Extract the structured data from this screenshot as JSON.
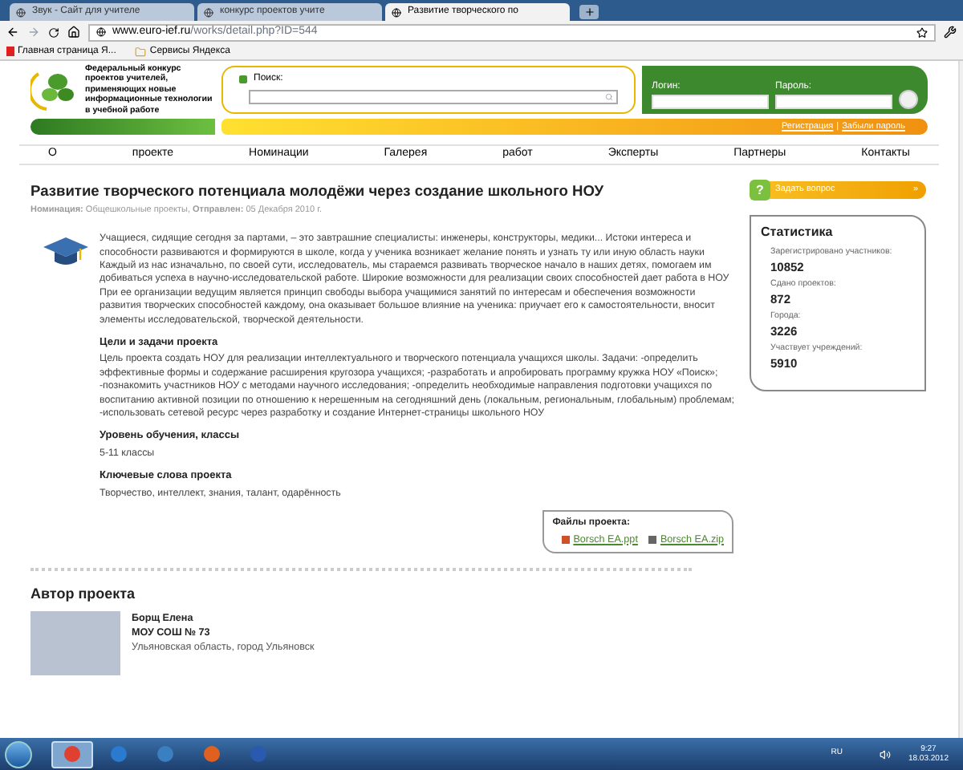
{
  "browser": {
    "tabs": [
      {
        "label": "Звук - Сайт для учителе",
        "selected": false
      },
      {
        "label": "конкурс проектов учите",
        "selected": false
      },
      {
        "label": "Развитие творческого по",
        "selected": true
      }
    ],
    "url_host": "www.euro-ief.ru",
    "url_path": "/works/detail.php?ID=544",
    "bookmarks": [
      {
        "label": "Главная страница Я...",
        "kind": "page"
      },
      {
        "label": "Сервисы Яндекса",
        "kind": "folder"
      }
    ]
  },
  "header": {
    "logo_text": "Федеральный конкурс проектов учителей, применяющих новые информационные технологии в учебной работе",
    "search_label": "Поиск:",
    "login_label": "Логин:",
    "password_label": "Пароль:",
    "links": [
      "Регистрация",
      "Забыли пароль"
    ],
    "link_separator": "|"
  },
  "nav": [
    "О",
    "проекте",
    "Номинации",
    "Галерея",
    "работ",
    "Эксперты",
    "Партнеры",
    "Контакты"
  ],
  "article": {
    "title": "Развитие творческого потенциала молодёжи через создание школьного НОУ",
    "meta": "**Номинация:** Общешкольные проекты, **Отправлен:** 05 Декабря 2010 г.",
    "intro": "Учащиеся, сидящие сегодня за партами, – это завтрашние специалисты: инженеры, конструкторы, медики... Истоки интереса и способности развиваются и формируются в школе, когда у ученика возникает желание понять и узнать ту или иную область науки Каждый из нас изначально, по своей сути, исследователь, мы стараемся развивать творческое начало в наших детях, помогаем им добиваться успеха в научно-исследовательской работе. Широкие возможности для реализации своих способностей дает работа в НОУ При ее организации ведущим является принцип свободы выбора учащимися занятий по интересам и обеспечения возможности развития творческих способностей каждому, она оказывает большое влияние на ученика: приучает его к самостоятельности, вносит элементы исследовательской, творческой деятельности.",
    "sections": [
      {
        "heading": "Цели и задачи проекта",
        "text": "Цель проекта создать НОУ для реализации интеллектуального и творческого потенциала учащихся школы. Задачи: -определить эффективные формы и содержание расширения кругозора учащихся; -разработать и апробировать программу кружка НОУ «Поиск»; -познакомить участников НОУ с методами научного исследования; -определить необходимые направления подготовки учащихся по воспитанию активной позиции по отношению к нерешенным на сегодняшний день (локальным, региональным, глобальным) проблемам; -использовать сетевой ресурс через разработку и создание Интернет-страницы школьного НОУ"
      },
      {
        "heading": "Уровень обучения, классы",
        "text": "5-11 классы"
      },
      {
        "heading": "Ключевые слова проекта",
        "text": "Творчество, интеллект, знания, талант, одарённость"
      }
    ],
    "files_title": "Файлы проекта:",
    "files": [
      {
        "name": "Borsch EA.ppt",
        "kind": "ppt"
      },
      {
        "name": "Borsch EA.zip",
        "kind": "zip"
      }
    ]
  },
  "author": {
    "heading": "Автор проекта",
    "name": "Борщ Елена",
    "school": "МОУ СОШ № 73",
    "location": "Ульяновская область, город Ульяновск"
  },
  "sidebar": {
    "ask_icon": "?",
    "ask_label": "Задать вопрос",
    "ask_arrow": "»",
    "stats_title": "Статистика",
    "stats": [
      {
        "label": "Зарегистрировано участников:",
        "value": "10852"
      },
      {
        "label": "Сдано проектов:",
        "value": "872"
      },
      {
        "label": "Города:",
        "value": "3226"
      },
      {
        "label": "Участвует учреждений:",
        "value": "5910"
      }
    ]
  },
  "taskbar": {
    "apps": [
      {
        "kind": "browser",
        "selected": true
      },
      {
        "kind": "ie",
        "selected": false
      },
      {
        "kind": "mail",
        "selected": false
      },
      {
        "kind": "slides",
        "selected": false
      },
      {
        "kind": "doc",
        "selected": false
      }
    ],
    "language": "RU",
    "time": "9:27",
    "date": "18.03.2012"
  }
}
